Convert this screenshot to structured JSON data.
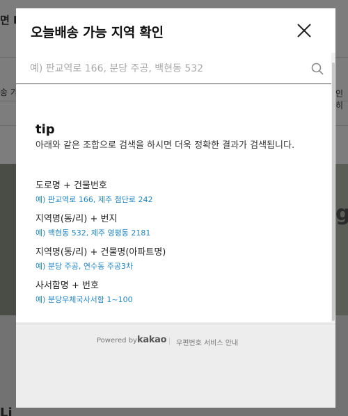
{
  "background": {
    "top_left_text": "면 I",
    "tab_left": "송 가",
    "tab_right": "인히",
    "banner_right_word": "g",
    "bottom_left_text": "Li"
  },
  "modal": {
    "title": "오늘배송 가능 지역 확인",
    "search": {
      "value": "",
      "placeholder": "예) 판교역로 166, 분당 주공, 백현동 532"
    },
    "tip": {
      "title": "tip",
      "description": "아래와 같은 조합으로 검색을 하시면 더욱 정확한 결과가 검색됩니다.",
      "examples": [
        {
          "label": "도로명 + 건물번호",
          "value": "예) 판교역로 166,  제주 첨단로 242"
        },
        {
          "label": "지역명(동/리) + 번지",
          "value": "예) 백현동 532,  제주 영평동 2181"
        },
        {
          "label": "지역명(동/리) + 건물명(아파트명)",
          "value": "예) 분당 주공,  연수동 주공3차"
        },
        {
          "label": "사서함명 + 번호",
          "value": "예) 분당우체국사서함 1~100"
        }
      ]
    },
    "footer": {
      "powered_by": "Powered by",
      "brand": "kakao",
      "postal_service_link": "우편번호 서비스 안내"
    }
  }
}
